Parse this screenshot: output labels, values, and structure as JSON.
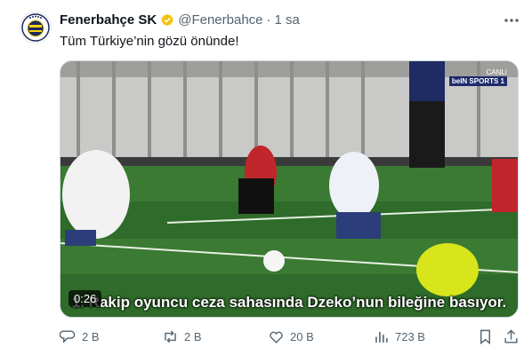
{
  "tweet": {
    "author_name": "Fenerbahçe SK",
    "handle": "@Fenerbahce",
    "separator": "·",
    "time": "1 sa",
    "text": "Tüm Türkiye’nin gözü önünde!"
  },
  "media": {
    "duration": "0:26",
    "subtitle": "1. Rakip oyuncu ceza sahasında Dzeko’nun bileğine basıyor.",
    "broadcaster_top": "CANLI",
    "broadcaster_name": "beIN SPORTS 1"
  },
  "actions": {
    "replies": "2 B",
    "retweets": "2 B",
    "likes": "20 B",
    "views": "723 B"
  },
  "colors": {
    "text_primary": "#0f1419",
    "text_secondary": "#536471",
    "verified": "#f4c20d",
    "pitch": "#2f6b2a"
  },
  "icons": [
    "verified-badge-icon",
    "more-icon",
    "reply-icon",
    "retweet-icon",
    "like-icon",
    "views-icon",
    "bookmark-icon",
    "share-icon"
  ]
}
